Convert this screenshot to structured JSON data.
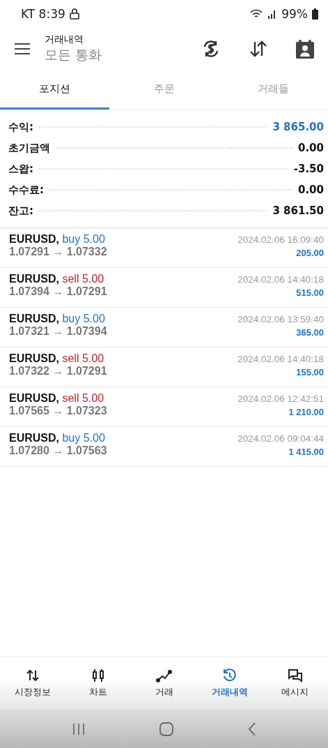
{
  "status_bar": {
    "carrier_time": "KT 8:39",
    "battery": "99%"
  },
  "header": {
    "title": "거래내역",
    "subtitle": "모든 통화"
  },
  "tabs": [
    {
      "label": "포지션",
      "selected": true
    },
    {
      "label": "주문",
      "selected": false
    },
    {
      "label": "거래들",
      "selected": false
    }
  ],
  "summary": [
    {
      "label": "수익:",
      "value": "3 865.00",
      "accent": true
    },
    {
      "label": "초기금액",
      "value": "0.00",
      "accent": false
    },
    {
      "label": "스왑:",
      "value": "-3.50",
      "accent": false
    },
    {
      "label": "수수료:",
      "value": "0.00",
      "accent": false
    },
    {
      "label": "잔고:",
      "value": "3 861.50",
      "accent": false
    }
  ],
  "trades": [
    {
      "symbol": "EURUSD,",
      "side": "buy",
      "lots": "5.00",
      "prices": "1.07291 → 1.07332",
      "time": "2024.02.06 16:09:40",
      "profit": "205.00"
    },
    {
      "symbol": "EURUSD,",
      "side": "sell",
      "lots": "5.00",
      "prices": "1.07394 → 1.07291",
      "time": "2024.02.06 14:40:18",
      "profit": "515.00"
    },
    {
      "symbol": "EURUSD,",
      "side": "buy",
      "lots": "5.00",
      "prices": "1.07321 → 1.07394",
      "time": "2024.02.06 13:59:40",
      "profit": "365.00"
    },
    {
      "symbol": "EURUSD,",
      "side": "sell",
      "lots": "5.00",
      "prices": "1.07322 → 1.07291",
      "time": "2024.02.06 14:40:18",
      "profit": "155.00"
    },
    {
      "symbol": "EURUSD,",
      "side": "sell",
      "lots": "5.00",
      "prices": "1.07565 → 1.07323",
      "time": "2024.02.06 12:42:51",
      "profit": "1 210.00"
    },
    {
      "symbol": "EURUSD,",
      "side": "buy",
      "lots": "5.00",
      "prices": "1.07280 → 1.07563",
      "time": "2024.02.06 09:04:44",
      "profit": "1 415.00"
    }
  ],
  "bottom_nav": [
    {
      "kind": "quotes",
      "label": "시장정보",
      "selected": false
    },
    {
      "kind": "chart",
      "label": "차트",
      "selected": false
    },
    {
      "kind": "trade",
      "label": "거래",
      "selected": false
    },
    {
      "kind": "history",
      "label": "거래내역",
      "selected": true
    },
    {
      "kind": "messages",
      "label": "메시지",
      "selected": false
    }
  ]
}
